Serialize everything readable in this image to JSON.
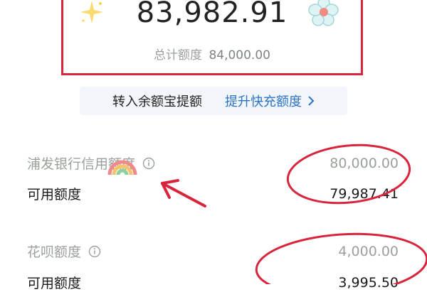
{
  "summary": {
    "amount": "83,982.91",
    "total_label": "总计额度",
    "total_value": "84,000.00"
  },
  "actions": {
    "transfer_label": "转入余额宝提额",
    "raise_label": "提升快充额度"
  },
  "bank_card": {
    "label": "浦发银行信用额度",
    "value": "80,000.00",
    "available_label": "可用额度",
    "available_value": "79,987.41"
  },
  "huabei": {
    "label": "花呗额度",
    "value": "4,000.00",
    "available_label": "可用额度",
    "available_value": "3,995.50"
  },
  "icons": [
    "sparkle-icon",
    "flower-icon",
    "chevron-right-icon",
    "info-icon",
    "arrow-annotation-icon",
    "rainbow-sticker-icon"
  ],
  "colors": {
    "annotation_red": "#d9253b",
    "link_blue": "#2a73c7",
    "muted_gray": "#9aa19b"
  }
}
